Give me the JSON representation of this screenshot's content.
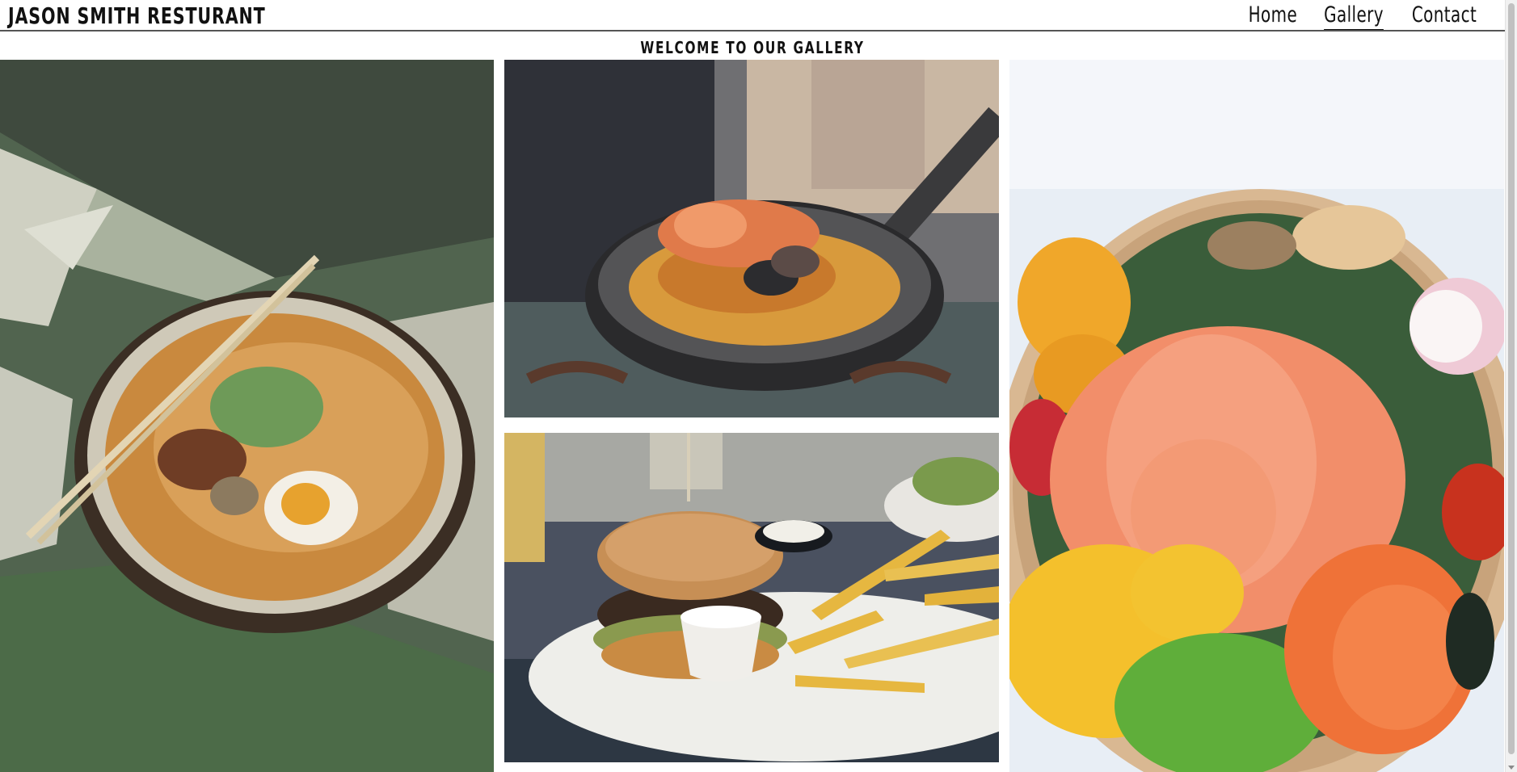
{
  "header": {
    "brand": "JASON SMITH RESTURANT",
    "nav": [
      {
        "label": "Home"
      },
      {
        "label": "Gallery",
        "active": true
      },
      {
        "label": "Contact"
      }
    ]
  },
  "gallery": {
    "heading": "WELCOME TO OUR GALLERY"
  },
  "colors": {
    "text": "#111111",
    "header_rule": "#555555",
    "background": "#ffffff"
  }
}
